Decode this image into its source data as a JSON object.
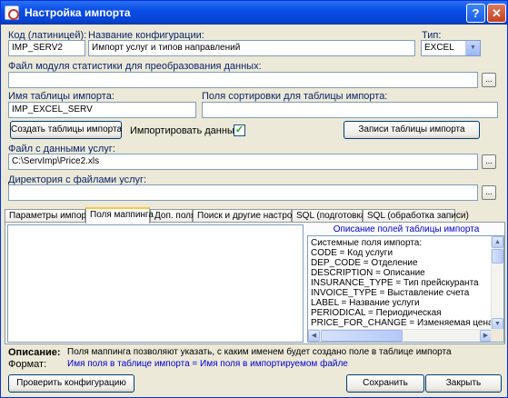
{
  "window": {
    "title": "Настройка импорта",
    "help": "?",
    "close": "✕"
  },
  "fields": {
    "code_label": "Код (латиницей):",
    "code_value": "IMP_SERV2",
    "name_label": "Название конфигурации:",
    "name_value": "Импорт услуг и типов направлений",
    "type_label": "Тип:",
    "type_value": "EXCEL",
    "stat_label": "Файл модуля статистики для преобразования данных:",
    "stat_value": "",
    "table_label": "Имя таблицы импорта:",
    "table_value": "IMP_EXCEL_SERV",
    "sort_label": "Поля сортировки для таблицы импорта:",
    "sort_value": "",
    "data_file_label": "Файл с данными услуг:",
    "data_file_value": "C:\\ServImp\\Price2.xls",
    "dir_label": "Директория с файлами услуг:",
    "dir_value": ""
  },
  "buttons": {
    "create_tables": "Создать таблицы импорта",
    "table_records": "Записи таблицы импорта",
    "check_config": "Проверить конфигурацию",
    "save": "Сохранить",
    "close": "Закрыть",
    "browse": "..."
  },
  "import_data": {
    "label": "Импортировать данные",
    "checked": true,
    "mark": "✓"
  },
  "tabs": [
    {
      "label": "Параметры импорта",
      "active": false
    },
    {
      "label": "Поля маппинга",
      "active": true
    },
    {
      "label": "Доп. поля",
      "active": false
    },
    {
      "label": "Поиск и другие настройки",
      "active": false
    },
    {
      "label": "SQL (подготовка)",
      "active": false
    },
    {
      "label": "SQL (обработка записи)",
      "active": false
    }
  ],
  "desc_panel": {
    "header": "Описание полей таблицы импорта",
    "lines": [
      "Системные поля импорта:",
      "CODE = Код услуги",
      "DEP_CODE = Отделение",
      "DESCRIPTION = Описание",
      "INSURANCE_TYPE = Тип прейскуранта",
      "INVOICE_TYPE = Выставление счета",
      "LABEL = Название услуги",
      "PERIODICAL = Периодическая",
      "PRICE_FOR_CHANGE = Изменяемая цена"
    ]
  },
  "footer": {
    "desc_label": "Описание:",
    "desc_text": "Поля маппинга позволяют указать, с каким именем будет создано поле в таблице импорта",
    "format_label": "Формат:",
    "format_text": "Имя поля в таблице импорта = Имя поля в импортируемом файле"
  },
  "colors": {
    "title_bar": "#0a4ee6",
    "window_bg": "#ece9d8",
    "label_blue": "#0a246a",
    "link_blue": "#0000d0",
    "tab_highlight": "#ffc83c"
  }
}
